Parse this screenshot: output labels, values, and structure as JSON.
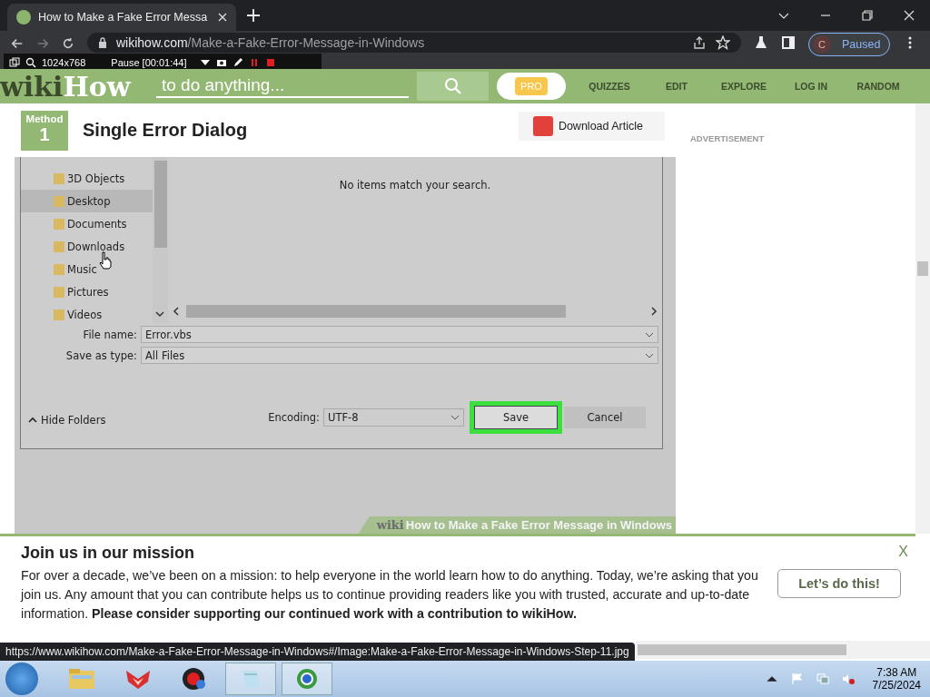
{
  "browser": {
    "tab_title": "How to Make a Fake Error Messa",
    "url_host": "wikihow.com",
    "url_path": "/Make-a-Fake-Error-Message-in-Windows",
    "profile_initial": "C",
    "profile_status": "Paused"
  },
  "recorder": {
    "size": "1024x768",
    "timer": "Pause [00:01:44]"
  },
  "site": {
    "logo_wiki": "wiki",
    "logo_how": "How",
    "search_placeholder": "to do anything...",
    "pro": "PRO",
    "nav": [
      "QUIZZES",
      "EDIT",
      "EXPLORE",
      "LOG IN",
      "RANDOM"
    ]
  },
  "section": {
    "method_label": "Method",
    "method_number": "1",
    "title": "Single Error Dialog",
    "download": "Download Article",
    "ad": "ADVERTISEMENT"
  },
  "dialog": {
    "folders": [
      {
        "label": "3D Objects",
        "selected": false
      },
      {
        "label": "Desktop",
        "selected": true
      },
      {
        "label": "Documents",
        "selected": false
      },
      {
        "label": "Downloads",
        "selected": false
      },
      {
        "label": "Music",
        "selected": false
      },
      {
        "label": "Pictures",
        "selected": false
      },
      {
        "label": "Videos",
        "selected": false
      }
    ],
    "empty_message": "No items match your search.",
    "file_name_label": "File name:",
    "file_name": "Error.vbs",
    "type_label": "Save as type:",
    "type": "All Files",
    "hide_folders": "Hide Folders",
    "encoding_label": "Encoding:",
    "encoding": "UTF-8",
    "save": "Save",
    "cancel": "Cancel"
  },
  "caption": {
    "wiki": "wiki",
    "rest": "How to Make a Fake Error Message in Windows"
  },
  "banner": {
    "title": "Join us in our mission",
    "body": "For over a decade, we’ve been on a mission: to help everyone in the world learn how to do anything. Today, we’re asking that you join us. Any amount that you can contribute helps us to continue providing readers like you with trusted, accurate and up-to-date information. **Please consider supporting our continued work with a contribution to wikiHow.**",
    "button": "Let’s do this!",
    "close": "X"
  },
  "status_url": "https://www.wikihow.com/Make-a-Fake-Error-Message-in-Windows#/Image:Make-a-Fake-Error-Message-in-Windows-Step-11.jpg",
  "taskbar": {
    "time": "7:38 AM",
    "date": "7/25/2024"
  }
}
